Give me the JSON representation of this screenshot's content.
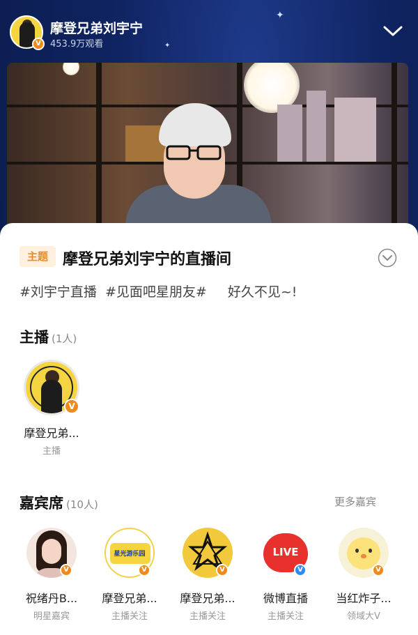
{
  "header": {
    "host_name": "摩登兄弟刘宇宁",
    "viewers": "453.9万观看",
    "verified_mark": "V"
  },
  "room": {
    "theme_badge": "主题",
    "title": "摩登兄弟刘宇宁的直播间",
    "tags": [
      "#刘宇宁直播",
      "#见面吧星朋友#"
    ],
    "greeting": "好久不见~!"
  },
  "anchors": {
    "title": "主播",
    "count": "(1人)",
    "items": [
      {
        "name": "摩登兄弟...",
        "role": "主播"
      }
    ]
  },
  "guests": {
    "title": "嘉宾席",
    "count": "(10人)",
    "more": "更多嘉宾",
    "items": [
      {
        "name": "祝绪丹B...",
        "role": "明星嘉宾"
      },
      {
        "name": "摩登兄弟...",
        "role": "主播关注",
        "logo_text": "星光游乐园"
      },
      {
        "name": "摩登兄弟...",
        "role": "主播关注"
      },
      {
        "name": "微博直播",
        "role": "主播关注",
        "logo_text": "LIVE"
      },
      {
        "name": "当红炸子...",
        "role": "领域大V"
      }
    ]
  },
  "colors": {
    "accent_orange": "#ef8a2b",
    "badge_bg": "#fff1de",
    "verified_orange": "#f08a1c",
    "verified_blue": "#2d8cf0"
  }
}
